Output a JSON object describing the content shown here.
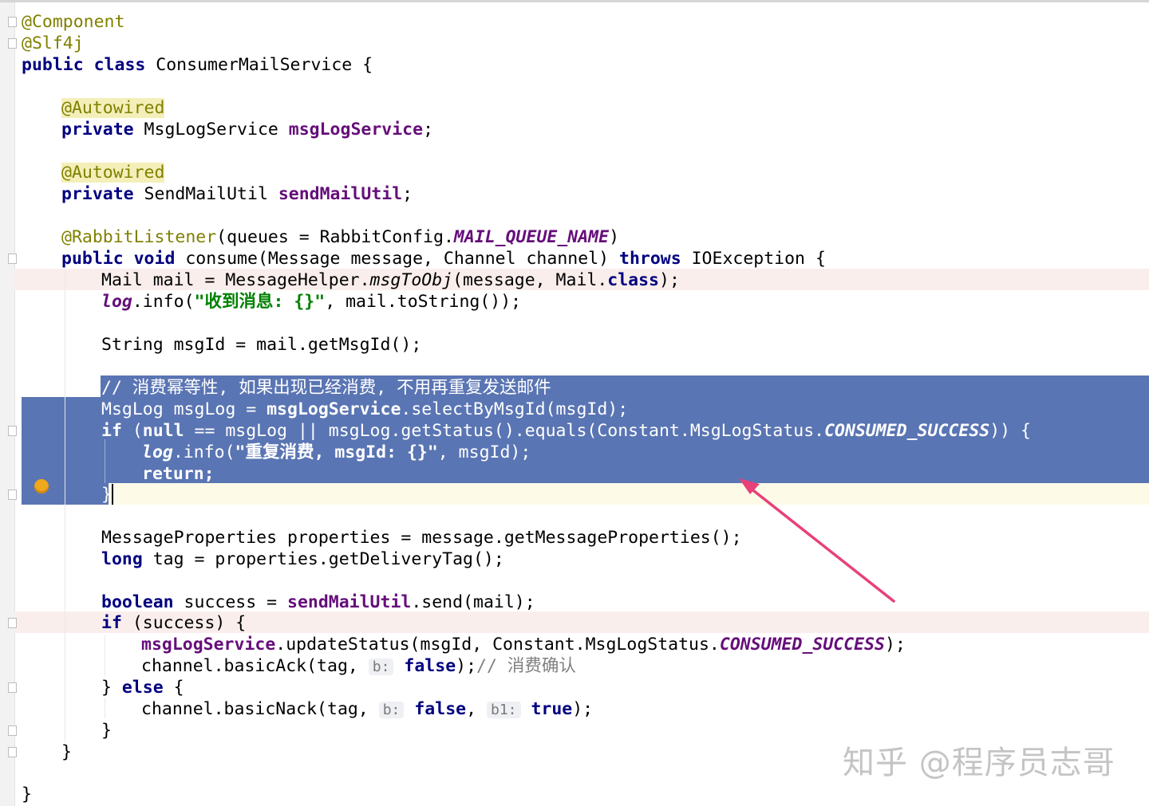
{
  "code": {
    "l1": "@Component",
    "l2": "@Slf4j",
    "l3_kw": "public class",
    "l3_rest": " ConsumerMailService {",
    "autowired": "@Autowired",
    "private_kw": "private",
    "msglogservice_type": " MsgLogService ",
    "msglogservice_field": "msgLogService",
    "semicolon": ";",
    "sendmailutil_type": " SendMailUtil ",
    "sendmailutil_field": "sendMailUtil",
    "rabbit_ann": "@RabbitListener",
    "rabbit_args": "(queues = RabbitConfig.",
    "rabbit_const": "MAIL_QUEUE_NAME",
    "rabbit_close": ")",
    "consume_kw": "public void",
    "consume_sig": " consume(Message message, Channel channel) ",
    "throws_kw": "throws",
    "consume_rest": " IOException {",
    "mail_a": "Mail mail = MessageHelper.",
    "mail_method": "msgToObj",
    "mail_b": "(message, Mail.",
    "class_kw": "class",
    "mail_c": ");",
    "log": "log",
    "log_info_open": ".info(",
    "log_str1": "\"收到消息: {}\"",
    "log_rest1": ", mail.toString());",
    "msgid_line": "String msgId = mail.getMsgId();",
    "comment_dedupe": "// 消费幂等性, 如果出现已经消费, 不用再重复发送邮件",
    "msglog_a": "MsgLog msgLog = ",
    "msglog_b": "msgLogService",
    "msglog_c": ".selectByMsgId(msgId);",
    "if_kw": "if",
    "if_a": " (",
    "null_kw": "null",
    "if_b": " == msgLog || msgLog.getStatus().equals(Constant.MsgLogStatus.",
    "consumed_success": "CONSUMED_SUCCESS",
    "if_c": ")) {",
    "log_str2": "\"重复消费, msgId: {}\"",
    "log_rest2": ", msgId);",
    "return_kw": "return;",
    "close_brace": "}",
    "props_line": "MessageProperties properties = message.getMessageProperties();",
    "long_kw": "long",
    "long_rest": " tag = properties.getDeliveryTag();",
    "boolean_kw": "boolean",
    "boolean_a": " success = ",
    "boolean_b": "sendMailUtil",
    "boolean_c": ".send(mail);",
    "if_success": " (success) {",
    "update_a": "msgLogService",
    "update_b": ".updateStatus(msgId, Constant.MsgLogStatus.",
    "update_c": ");",
    "ack_a": "channel.basicAck(tag, ",
    "hint_b": "b:",
    "false_kw": "false",
    "ack_b": ");",
    "ack_comment": "// 消费确认",
    "else_a": "} ",
    "else_kw": "else",
    "else_b": " {",
    "nack_a": "channel.basicNack(tag, ",
    "comma_sp": ", ",
    "hint_b1": "b1:",
    "true_kw": "true",
    "nack_b": ");"
  },
  "watermark": "知乎 @程序员志哥",
  "colors": {
    "keyword": "#000080",
    "annotation": "#808000",
    "field": "#660e7a",
    "string": "#008000",
    "comment": "#808080",
    "selection": "#5a75b3",
    "arrow": "#e8417a"
  },
  "icons": {
    "intention": "bulb-icon",
    "fold": "fold-marker-icon"
  }
}
